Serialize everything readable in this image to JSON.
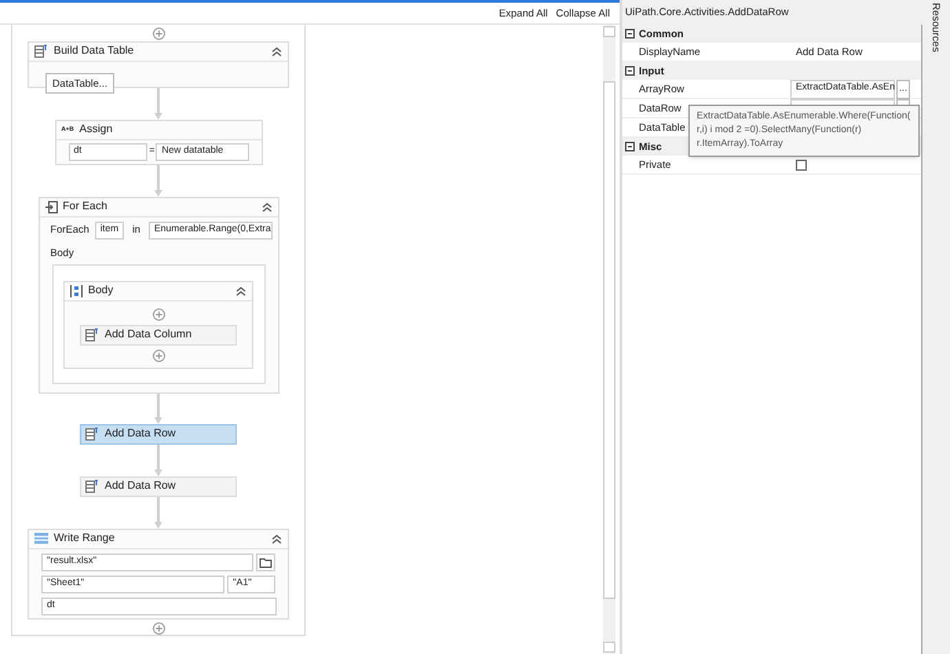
{
  "toolbar": {
    "links": [
      "Expand All",
      "Collapse All"
    ]
  },
  "workflow": {
    "activities": [
      {
        "kind": "build_data_table",
        "title": "Build Data Table",
        "button": "DataTable..."
      },
      {
        "kind": "assign",
        "title": "Assign",
        "icon_label": "A+B",
        "to": "dt",
        "operator": "=",
        "value": "New datatable"
      },
      {
        "kind": "for_each",
        "title": "For Each",
        "label": "ForEach",
        "item": "item",
        "in_label": "in",
        "values": "Enumerable.Range(0,Extra",
        "body_label": "Body",
        "body": {
          "title": "Body",
          "activities": [
            {
              "kind": "activity",
              "title": "Add Data Column",
              "selected": false
            }
          ]
        }
      },
      {
        "kind": "activity",
        "title": "Add Data Row",
        "selected": true
      },
      {
        "kind": "activity",
        "title": "Add Data Row",
        "selected": false
      },
      {
        "kind": "write_range",
        "title": "Write Range",
        "workbook": "\"result.xlsx\"",
        "sheet": "\"Sheet1\"",
        "cell": "\"A1\"",
        "data": "dt"
      }
    ]
  },
  "properties": {
    "title": "UiPath.Core.Activities.AddDataRow",
    "categories": [
      {
        "name": "Common",
        "expanded": true,
        "rows": [
          {
            "name": "DisplayName",
            "kind": "text",
            "value": "Add Data Row"
          }
        ]
      },
      {
        "name": "Input",
        "expanded": true,
        "rows": [
          {
            "name": "ArrayRow",
            "kind": "expression",
            "value": "ExtractDataTable.AsEn",
            "button": "..."
          },
          {
            "name": "DataRow",
            "kind": "expression"
          },
          {
            "name": "DataTable",
            "kind": "covered"
          }
        ]
      },
      {
        "name": "Misc",
        "expanded": true,
        "rows": [
          {
            "name": "Private",
            "kind": "checkbox",
            "checked": false
          }
        ]
      }
    ],
    "tooltip": "ExtractDataTable.AsEnumerable.Where(Function(r,i) i mod 2 =0).SelectMany(Function(r) r.ItemArray).ToArray"
  },
  "side_tab": "Resources"
}
